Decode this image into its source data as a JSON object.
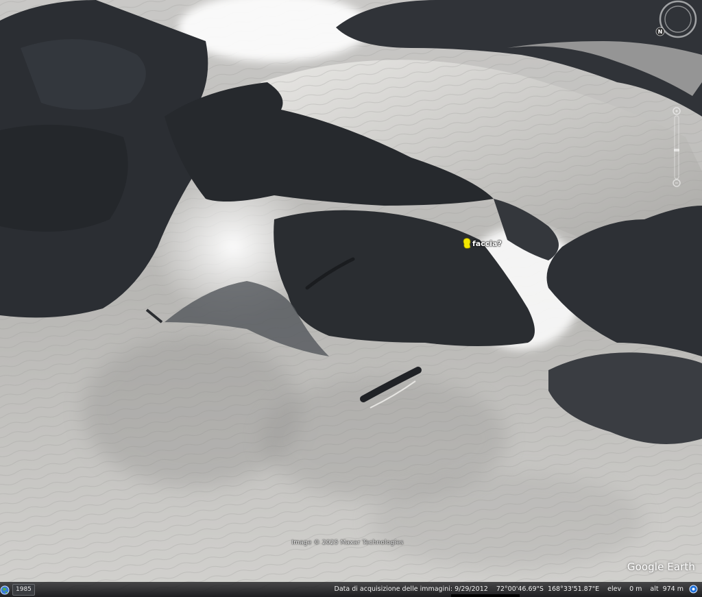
{
  "app": {
    "logo": "Google Earth"
  },
  "map": {
    "copyright": "Image © 2025 Maxar Technologies",
    "placemark": {
      "label": "faccia?",
      "icon": "yellow-pushpin-icon",
      "color": "#f2e600"
    }
  },
  "controls": {
    "compass_icon": "compass-icon",
    "compass_letter": "N",
    "zoom_icon": "zoom-slider-icon"
  },
  "statusbar": {
    "historical_year": "1985",
    "acquisition": "Data di acquisizione delle immagini: 9/29/2012",
    "latitude": "72°00'46.69\"S",
    "longitude": "168°33'51.87\"E",
    "elev_label": "elev",
    "elev_value": "0 m",
    "alt_label": "alt",
    "alt_value": "974 m",
    "globe_icon": "globe-icon",
    "info_icon": "info-icon"
  }
}
